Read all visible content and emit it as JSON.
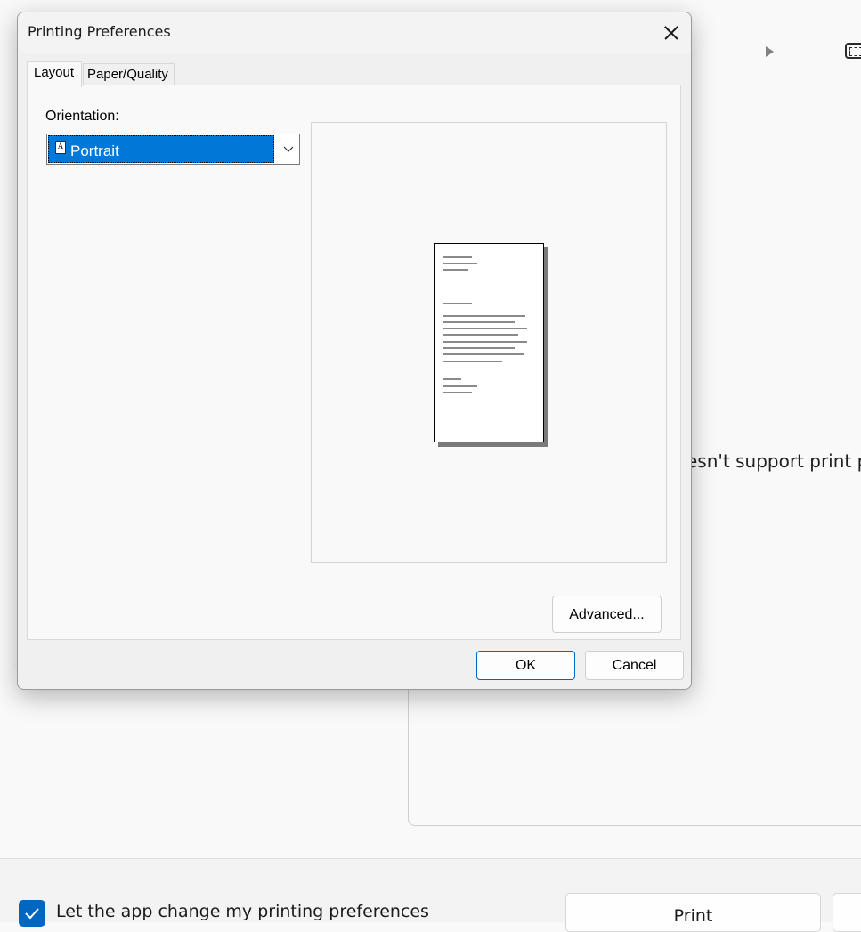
{
  "background": {
    "message": "esn't support print pr",
    "checkbox": {
      "label": "Let the app change my printing preferences",
      "checked": true
    },
    "print_button": "Print",
    "icons": [
      "play-icon",
      "fit-page-icon",
      "checkmark-icon"
    ],
    "accent_color": "#0067c0"
  },
  "dialog": {
    "title": "Printing Preferences",
    "tabs": [
      {
        "label": "Layout",
        "selected": true
      },
      {
        "label": "Paper/Quality",
        "selected": false
      }
    ],
    "orientation": {
      "label": "Orientation:",
      "value": "Portrait",
      "icon": "portrait-page-icon"
    },
    "preview": {
      "orientation": "portrait"
    },
    "buttons": {
      "advanced": "Advanced...",
      "ok": "OK",
      "cancel": "Cancel"
    },
    "icons": [
      "close-icon",
      "chevron-down-icon"
    ],
    "selection_color": "#0078d7"
  }
}
